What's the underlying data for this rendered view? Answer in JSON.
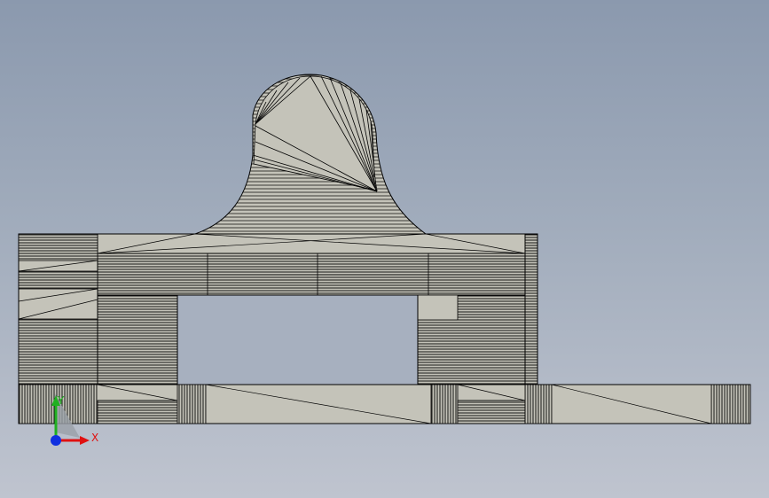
{
  "viewport": {
    "background_top": "#8b99ae",
    "background_bottom": "#bfc4cf"
  },
  "part": {
    "face_color": "#c4c3b9",
    "edge_color": "#000000",
    "render_style": "shaded-with-edges"
  },
  "triad": {
    "x_label": "X",
    "y_label": "Y",
    "x_color": "#e01010",
    "y_color": "#20b020",
    "z_color": "#1030e0"
  }
}
